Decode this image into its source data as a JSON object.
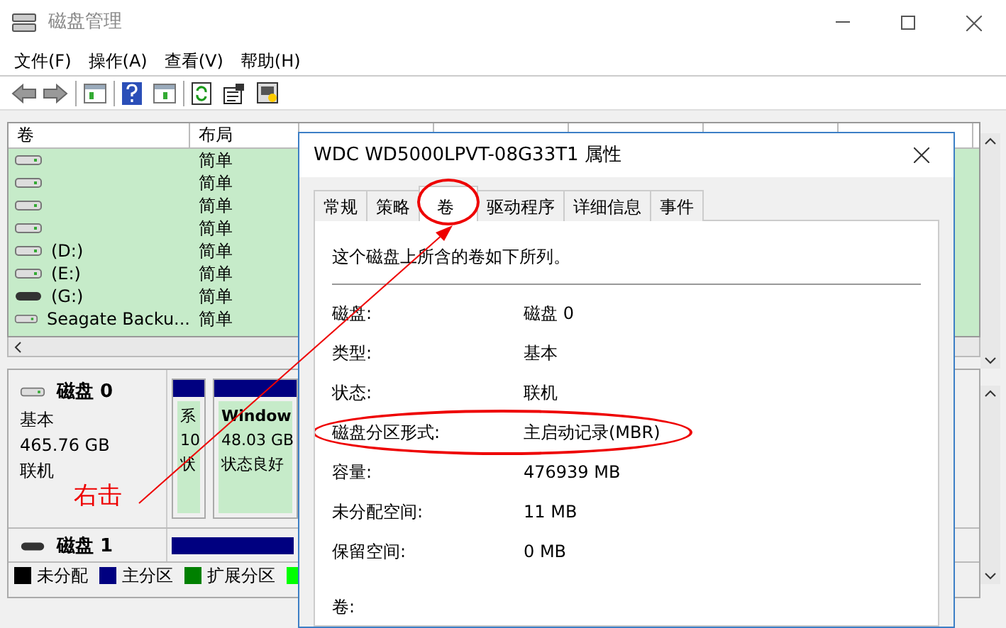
{
  "window": {
    "title": "磁盘管理"
  },
  "menu": [
    "文件(F)",
    "操作(A)",
    "查看(V)",
    "帮助(H)"
  ],
  "volume_list": {
    "columns": [
      "卷",
      "布局"
    ],
    "rows": [
      {
        "kind": "fixed",
        "layout": "简单"
      },
      {
        "kind": "fixed",
        "layout": "简单"
      },
      {
        "kind": "fixed",
        "layout": "简单"
      },
      {
        "kind": "fixed",
        "layout": "简单"
      },
      {
        "kind": "fixed",
        "volume": "(D:)",
        "layout": "简单"
      },
      {
        "kind": "fixed",
        "volume": "(E:)",
        "layout": "简单"
      },
      {
        "kind": "removable",
        "volume": "(G:)",
        "layout": "简单"
      },
      {
        "kind": "fixed",
        "volume": "Seagate Backu...",
        "layout": "简单"
      }
    ]
  },
  "disks": [
    {
      "kind": "fixed",
      "name": "磁盘 0",
      "type": "基本",
      "size": "465.76 GB",
      "status": "联机",
      "partitions": [
        {
          "lines": [
            "系",
            "10",
            "状"
          ]
        },
        {
          "lines": [
            "Window",
            "48.03 GB",
            "状态良好"
          ]
        }
      ]
    },
    {
      "kind": "removable",
      "name": "磁盘 1"
    }
  ],
  "legend": [
    {
      "label": "未分配",
      "color": "#000000"
    },
    {
      "label": "主分区",
      "color": "#000080"
    },
    {
      "label": "扩展分区",
      "color": "#008000"
    },
    {
      "color": "#00ff00"
    }
  ],
  "dialog": {
    "title": "WDC WD5000LPVT-08G33T1 属性",
    "tabs": [
      {
        "label": "常规",
        "selected": false,
        "circled": false
      },
      {
        "label": "策略",
        "selected": false,
        "circled": false
      },
      {
        "label": "卷",
        "selected": true,
        "circled": true
      },
      {
        "label": "驱动程序",
        "selected": false,
        "circled": false
      },
      {
        "label": "详细信息",
        "selected": false,
        "circled": false
      },
      {
        "label": "事件",
        "selected": false,
        "circled": false
      }
    ],
    "intro": "这个磁盘上所含的卷如下所列。",
    "properties": [
      {
        "label": "磁盘:",
        "value": "磁盘 0",
        "circled": false
      },
      {
        "label": "类型:",
        "value": "基本",
        "circled": false
      },
      {
        "label": "状态:",
        "value": "联机",
        "circled": false
      },
      {
        "label": "磁盘分区形式:",
        "value": "主启动记录(MBR)",
        "circled": true
      },
      {
        "label": "容量:",
        "value": "476939 MB",
        "circled": false
      },
      {
        "label": "未分配空间:",
        "value": "11 MB",
        "circled": false
      },
      {
        "label": "保留空间:",
        "value": "0 MB",
        "circled": false
      }
    ],
    "volumes_label": "卷:"
  },
  "annotation": {
    "callout": "右击"
  }
}
